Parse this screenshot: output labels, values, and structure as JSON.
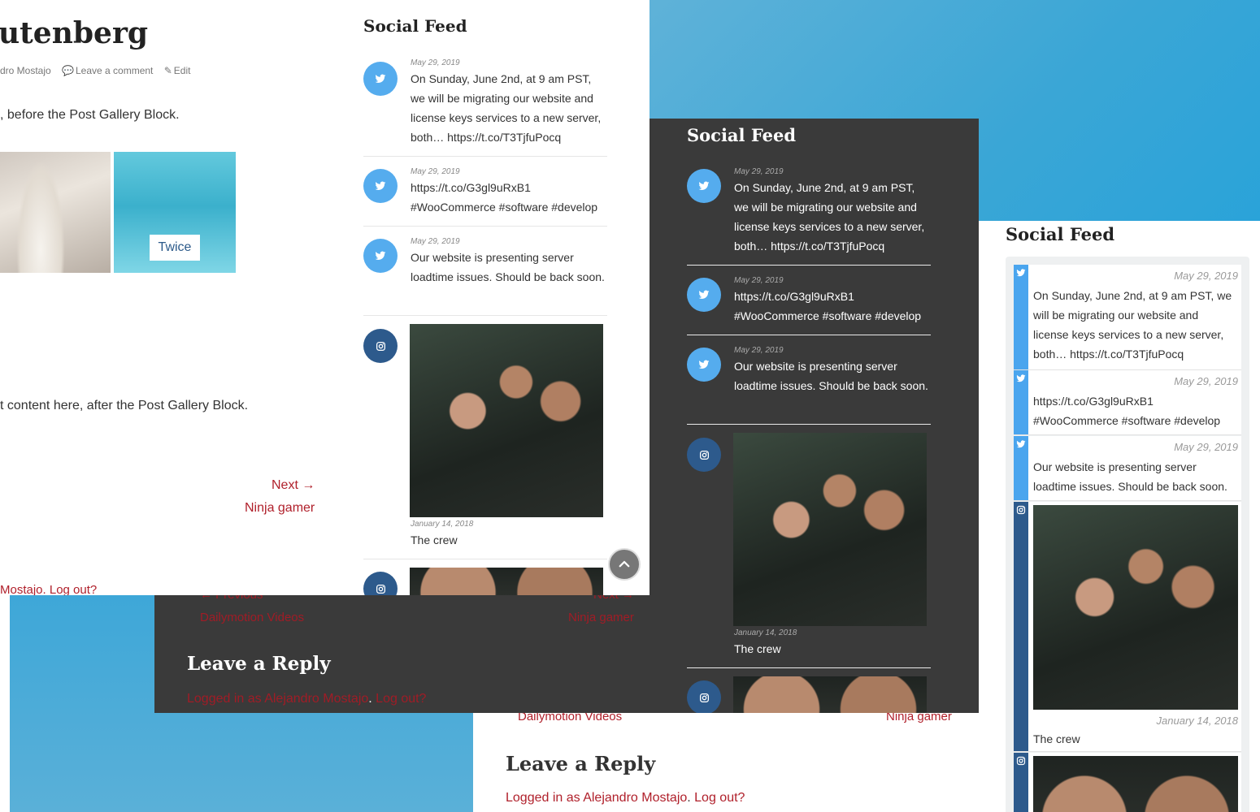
{
  "main": {
    "post_title": "utenberg",
    "meta": {
      "author": "dro Mostajo",
      "comment": "Leave a comment",
      "edit": "Edit"
    },
    "para_before": ", before the Post Gallery Block.",
    "gallery_caption": "Twice",
    "para_after": "t content here, after the Post Gallery Block.",
    "next_label": "Next →",
    "next_post": "Ninja gamer",
    "logged_tail": "Mostajo. Log out?"
  },
  "dark": {
    "prev_label": "← Previous",
    "prev_post": "Dailymotion Videos",
    "next_label": "Next →",
    "next_post": "Ninja gamer",
    "reply_title": "Leave a Reply",
    "logged_as": "Logged in as Alejandro Mostajo",
    "dot": ".",
    "logout": "Log out?"
  },
  "bottom": {
    "prev_post": "Dailymotion Videos",
    "next_post": "Ninja gamer",
    "reply_title": "Leave a Reply",
    "logged_as": "Logged in as Alejandro Mostajo",
    "logout": "Log out?"
  },
  "feed": {
    "title": "Social Feed",
    "items": [
      {
        "type": "twitter",
        "date": "May 29, 2019",
        "text": "On Sunday, June 2nd, at 9 am PST, we will be migrating our website and license keys services to a new server, both… https://t.co/T3TjfuPocq"
      },
      {
        "type": "twitter",
        "date": "May 29, 2019",
        "text": "https://t.co/G3gl9uRxB1 #WooCommerce #software #develop"
      },
      {
        "type": "twitter",
        "date": "May 29, 2019",
        "text": "Our website is presenting server loadtime issues. Should be back soon."
      },
      {
        "type": "instagram",
        "date": "January 14, 2018",
        "text": "The crew"
      }
    ]
  },
  "colors": {
    "accent_link": "#b0202b",
    "twitter": "#55acee",
    "instagram": "#2d5a8c",
    "dark_bg": "#3a3a3a"
  },
  "icons": [
    "twitter-icon",
    "instagram-icon",
    "comment-icon",
    "pencil-icon",
    "chevron-up-icon"
  ]
}
